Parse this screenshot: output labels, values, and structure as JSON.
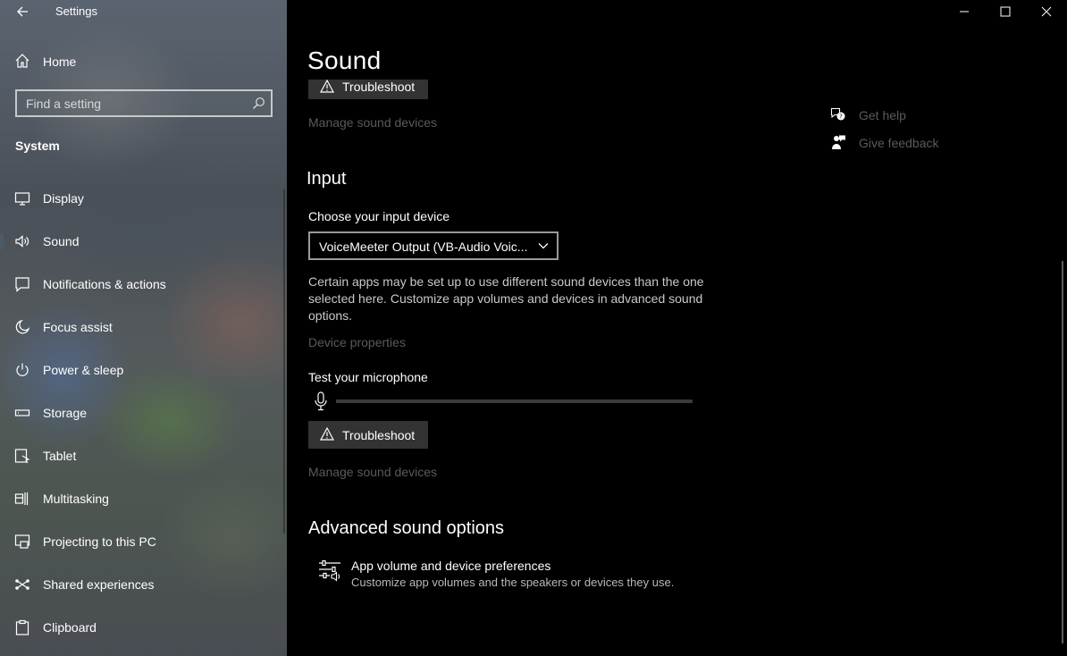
{
  "app": {
    "title": "Settings"
  },
  "sidebar": {
    "home_label": "Home",
    "search_placeholder": "Find a setting",
    "section_label": "System",
    "items": [
      {
        "label": "Display",
        "icon": "display-icon"
      },
      {
        "label": "Sound",
        "icon": "speaker-icon",
        "selected": true
      },
      {
        "label": "Notifications & actions",
        "icon": "notification-icon"
      },
      {
        "label": "Focus assist",
        "icon": "moon-icon"
      },
      {
        "label": "Power & sleep",
        "icon": "power-icon"
      },
      {
        "label": "Storage",
        "icon": "storage-icon"
      },
      {
        "label": "Tablet",
        "icon": "tablet-icon"
      },
      {
        "label": "Multitasking",
        "icon": "multitasking-icon"
      },
      {
        "label": "Projecting to this PC",
        "icon": "projecting-icon"
      },
      {
        "label": "Shared experiences",
        "icon": "shared-icon"
      },
      {
        "label": "Clipboard",
        "icon": "clipboard-icon"
      }
    ]
  },
  "main": {
    "title": "Sound",
    "output": {
      "troubleshoot_label": "Troubleshoot",
      "manage_devices_link": "Manage sound devices"
    },
    "input": {
      "heading": "Input",
      "choose_label": "Choose your input device",
      "selected_device": "VoiceMeeter Output (VB-Audio Voic...",
      "description": "Certain apps may be set up to use different sound devices than the one selected here. Customize app volumes and devices in advanced sound options.",
      "device_properties_link": "Device properties",
      "test_label": "Test your microphone",
      "mic_level_percent": 0,
      "troubleshoot_label": "Troubleshoot",
      "manage_devices_link": "Manage sound devices"
    },
    "advanced": {
      "heading": "Advanced sound options",
      "app_volume_title": "App volume and device preferences",
      "app_volume_desc": "Customize app volumes and the speakers or devices they use."
    },
    "help": {
      "get_help": "Get help",
      "give_feedback": "Give feedback"
    }
  },
  "colors": {
    "accent": "#0078d7",
    "button_bg": "#333333",
    "dim_link": "#5a5a5a"
  }
}
